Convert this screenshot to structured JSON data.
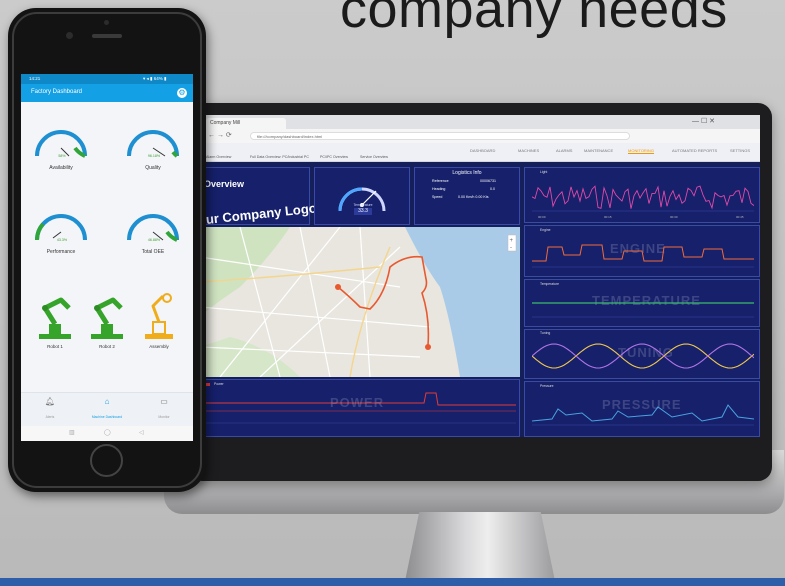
{
  "headline": "company needs",
  "colors": {
    "background": "#c4c4c4",
    "accent_blue": "#14a0e4",
    "dashboard_bg": "#15205a",
    "gauge_green": "#2fa53a",
    "robot_green": "#36a42b",
    "robot_yellow": "#f0ad1b",
    "bottom_bar": "#2f5ea8"
  },
  "phone": {
    "status_time": "14:21",
    "status_icons": "▾ ◂ ▮ 64% ▮",
    "app_title": "Factory Dashboard",
    "settings_icon": "gear-icon",
    "gauges": [
      {
        "label": "Availability",
        "value": "58%",
        "fill": 0.58
      },
      {
        "label": "Quality",
        "value": "96.18%",
        "fill": 0.96
      },
      {
        "label": "Performance",
        "value": "43.3%",
        "fill": 0.43
      },
      {
        "label": "Total OEE",
        "value": "46.88%",
        "fill": 0.47
      }
    ],
    "robots": [
      {
        "label": "Robot 1",
        "color": "#36a42b",
        "icon": "robot-arm-icon"
      },
      {
        "label": "Robot 2",
        "color": "#36a42b",
        "icon": "robot-arm-icon"
      },
      {
        "label": "Assembly",
        "color": "#f0ad1b",
        "icon": "robot-arm-icon"
      }
    ],
    "bottom_nav": [
      {
        "label": "Alerts",
        "icon": "bell-icon"
      },
      {
        "label": "Machine Dashboard",
        "icon": "home-icon"
      },
      {
        "label": "Monitor",
        "icon": "monitor-icon"
      }
    ],
    "system_nav": [
      "▥",
      "◯",
      "◁"
    ]
  },
  "monitor": {
    "browser": {
      "tab_title": "Company Mill",
      "window_controls": "—   ☐   ✕",
      "address": "file:///company/dashboard/index.html",
      "menu_items": [
        "DASHBOARD",
        "MACHINES",
        "ALARMS",
        "MAINTENANCE",
        "MONITORING",
        "AUTOMATED REPORTS",
        "SETTINGS"
      ],
      "active_menu": 4,
      "nav_items": [
        "Alarm Overview",
        "Full Data Overview: PC/Industrial PC",
        "PC/IPC Overview",
        "Service Overview"
      ]
    },
    "overview_title": "Overview",
    "company_logo": "Your Company Logo",
    "speed_gauge": {
      "label": "Temperature",
      "value": "33.3",
      "fill": 0.45
    },
    "logistics": {
      "title": "Logistics Info",
      "rows": [
        {
          "key": "Reference",
          "value": "00006731"
        },
        {
          "key": "Heading",
          "value": "0.0"
        },
        {
          "key": "Speed",
          "value": "0.00 Km/h 0.00 Kts"
        }
      ]
    },
    "charts": [
      {
        "name": "Light",
        "ghost": "",
        "color": "#e04aa8"
      },
      {
        "name": "Engine",
        "ghost": "ENGINE",
        "color": "#f06b3a"
      },
      {
        "name": "Temperature",
        "ghost": "TEMPERATURE",
        "color": "#3bbd6b"
      },
      {
        "name": "Tuning",
        "ghost": "TUNING",
        "color": "#f2c94c"
      },
      {
        "name": "Power",
        "ghost": "POWER",
        "color": "#e23a3a"
      },
      {
        "name": "Pressure",
        "ghost": "PRESSURE",
        "color": "#4aa3e0"
      }
    ],
    "chart_ticks": [
      "00:00",
      "00:15",
      "00:30",
      "00:45"
    ]
  }
}
